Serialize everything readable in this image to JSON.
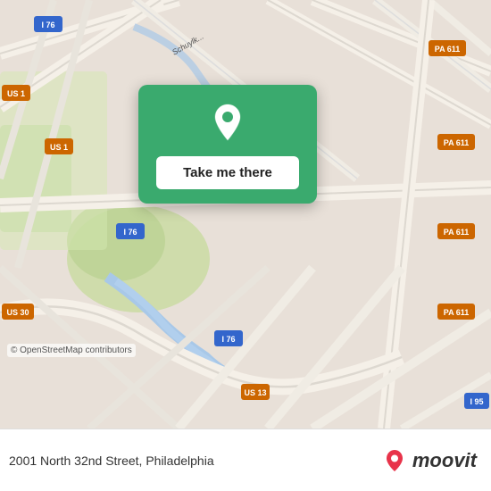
{
  "map": {
    "background_color": "#e8e0d8",
    "copyright": "© OpenStreetMap contributors"
  },
  "popup": {
    "button_label": "Take me there",
    "pin_color": "#ffffff",
    "background_color": "#3aaa6e"
  },
  "bottom_bar": {
    "address": "2001 North 32nd Street, Philadelphia",
    "logo_text": "moovit"
  },
  "road_labels": [
    {
      "id": "i76_top",
      "text": "I 76"
    },
    {
      "id": "us1_left",
      "text": "US 1"
    },
    {
      "id": "us1_mid",
      "text": "US 1"
    },
    {
      "id": "us1_road",
      "text": "US 1"
    },
    {
      "id": "pa611_top",
      "text": "PA 611"
    },
    {
      "id": "pa611_right1",
      "text": "PA 611"
    },
    {
      "id": "pa611_right2",
      "text": "PA 611"
    },
    {
      "id": "pa611_right3",
      "text": "PA 611"
    },
    {
      "id": "i76_mid",
      "text": "I 76"
    },
    {
      "id": "i76_bot",
      "text": "I 76"
    },
    {
      "id": "us30",
      "text": "US 30"
    },
    {
      "id": "us13",
      "text": "US 13"
    },
    {
      "id": "i95",
      "text": "I 95"
    }
  ]
}
